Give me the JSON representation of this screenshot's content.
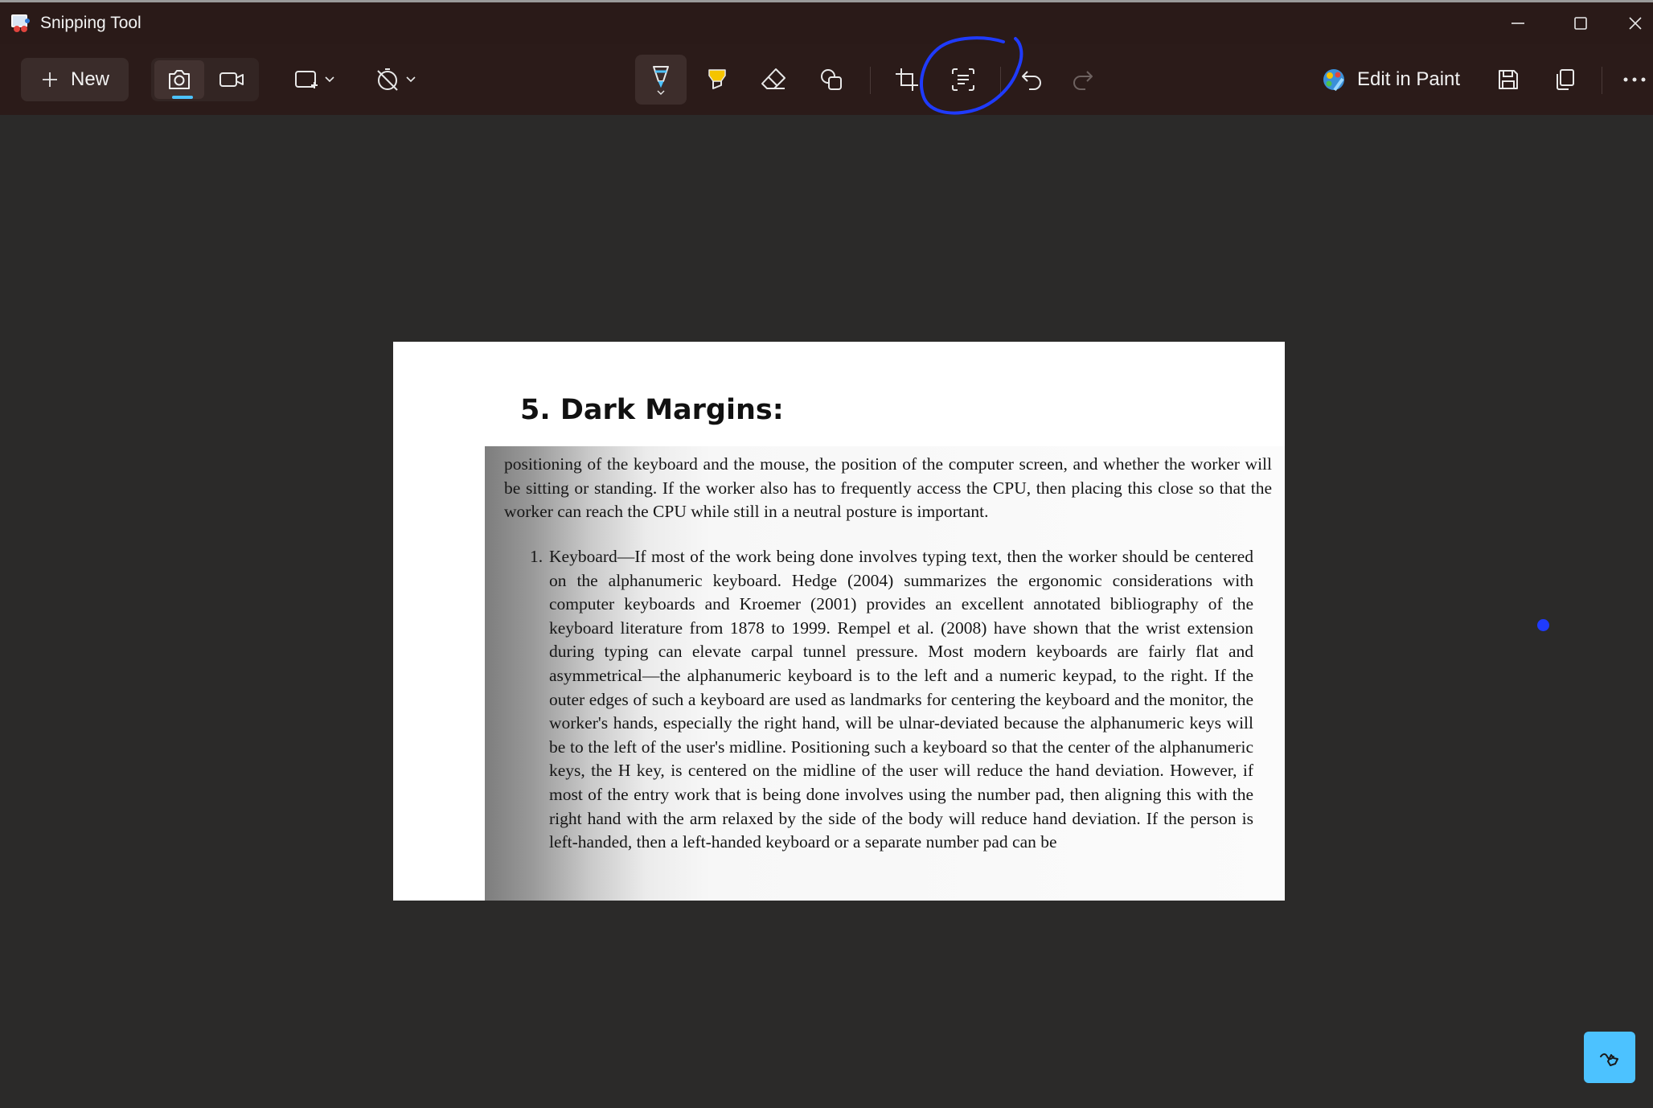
{
  "window": {
    "title": "Snipping Tool"
  },
  "toolbar": {
    "new_label": "New",
    "edit_in_paint_label": "Edit in Paint",
    "icons": [
      "camera-icon",
      "video-icon",
      "rectangle-mode-icon",
      "no-delay-timer-icon",
      "ballpoint-pen-icon",
      "highlighter-icon",
      "eraser-icon",
      "shapes-icon",
      "crop-icon",
      "text-actions-icon",
      "undo-icon",
      "redo-icon",
      "paint-icon",
      "save-icon",
      "copy-icon",
      "more-icon"
    ],
    "accent_color": "#4cc2ff",
    "highlighter_color": "#f5c400"
  },
  "document": {
    "heading": "5. Dark Margins:",
    "paragraph1": "positioning of the keyboard and the mouse, the position of the computer screen, and whether the worker will be sitting or standing. If the worker also has to frequently access the CPU, then placing this close so that the worker can reach the CPU while still in a neutral posture is important.",
    "item_number": "1.",
    "item_text": "Keyboard—If most of the work being done involves typing text, then the worker should be centered on the alphanumeric keyboard. Hedge (2004) summarizes the ergonomic considerations with computer keyboards and Kroemer (2001) provides an excellent annotated bibliography of the keyboard literature from 1878 to 1999. Rempel et al. (2008) have shown that the wrist extension during typing can elevate carpal tunnel pressure. Most modern keyboards are fairly flat and asymmetrical—the alphanumeric keyboard is to the left and a numeric keypad, to the right. If the outer edges of such a keyboard are used as landmarks for centering the keyboard and the monitor, the worker's hands, especially the right hand, will be ulnar-deviated because the alphanumeric keys will be to the left of the user's midline. Positioning such a keyboard so that the center of the alphanumeric keys, the H key, is centered on the midline of the user will reduce the hand deviation. However, if most of the entry work that is being done involves using the number pad, then aligning this with the right hand with the arm relaxed by the side of the body will reduce hand deviation. If the person is left-handed, then a left-handed keyboard or a separate number pad can be"
  },
  "annotation": {
    "color": "#1f3bff"
  }
}
